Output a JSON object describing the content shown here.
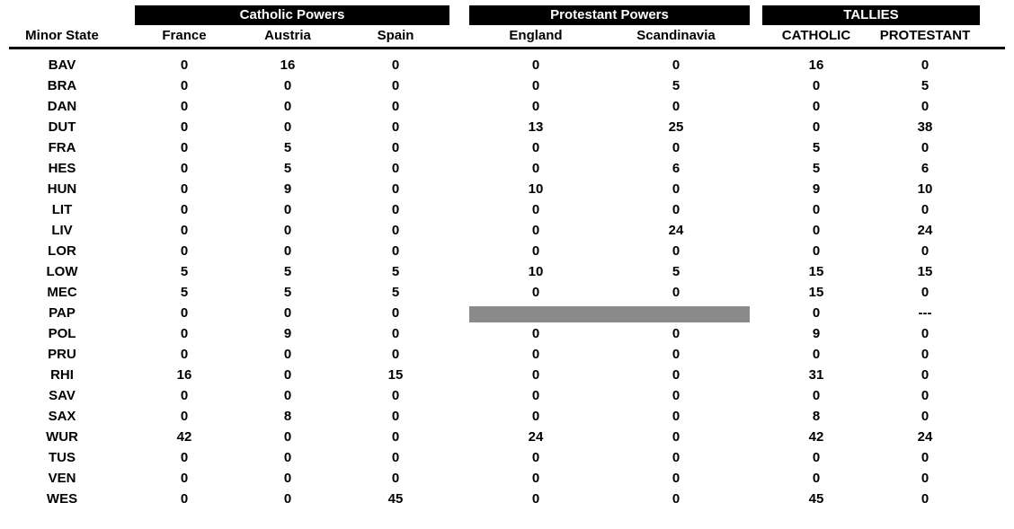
{
  "headers": {
    "minor_state": "Minor State",
    "group_catholic": "Catholic Powers",
    "group_protestant": "Protestant Powers",
    "group_tallies": "TALLIES",
    "france": "France",
    "austria": "Austria",
    "spain": "Spain",
    "england": "England",
    "scandinavia": "Scandinavia",
    "tally_catholic": "CATHOLIC",
    "tally_protestant": "PROTESTANT"
  },
  "chart_data": {
    "type": "table",
    "columns": [
      "Minor State",
      "France",
      "Austria",
      "Spain",
      "England",
      "Scandinavia",
      "CATHOLIC",
      "PROTESTANT"
    ],
    "rows": [
      {
        "state": "BAV",
        "france": "0",
        "austria": "16",
        "spain": "0",
        "england": "0",
        "scandinavia": "0",
        "tc": "16",
        "tp": "0",
        "grey": false
      },
      {
        "state": "BRA",
        "france": "0",
        "austria": "0",
        "spain": "0",
        "england": "0",
        "scandinavia": "5",
        "tc": "0",
        "tp": "5",
        "grey": false
      },
      {
        "state": "DAN",
        "france": "0",
        "austria": "0",
        "spain": "0",
        "england": "0",
        "scandinavia": "0",
        "tc": "0",
        "tp": "0",
        "grey": false
      },
      {
        "state": "DUT",
        "france": "0",
        "austria": "0",
        "spain": "0",
        "england": "13",
        "scandinavia": "25",
        "tc": "0",
        "tp": "38",
        "grey": false
      },
      {
        "state": "FRA",
        "france": "0",
        "austria": "5",
        "spain": "0",
        "england": "0",
        "scandinavia": "0",
        "tc": "5",
        "tp": "0",
        "grey": false
      },
      {
        "state": "HES",
        "france": "0",
        "austria": "5",
        "spain": "0",
        "england": "0",
        "scandinavia": "6",
        "tc": "5",
        "tp": "6",
        "grey": false
      },
      {
        "state": "HUN",
        "france": "0",
        "austria": "9",
        "spain": "0",
        "england": "10",
        "scandinavia": "0",
        "tc": "9",
        "tp": "10",
        "grey": false
      },
      {
        "state": "LIT",
        "france": "0",
        "austria": "0",
        "spain": "0",
        "england": "0",
        "scandinavia": "0",
        "tc": "0",
        "tp": "0",
        "grey": false
      },
      {
        "state": "LIV",
        "france": "0",
        "austria": "0",
        "spain": "0",
        "england": "0",
        "scandinavia": "24",
        "tc": "0",
        "tp": "24",
        "grey": false
      },
      {
        "state": "LOR",
        "france": "0",
        "austria": "0",
        "spain": "0",
        "england": "0",
        "scandinavia": "0",
        "tc": "0",
        "tp": "0",
        "grey": false
      },
      {
        "state": "LOW",
        "france": "5",
        "austria": "5",
        "spain": "5",
        "england": "10",
        "scandinavia": "5",
        "tc": "15",
        "tp": "15",
        "grey": false
      },
      {
        "state": "MEC",
        "france": "5",
        "austria": "5",
        "spain": "5",
        "england": "0",
        "scandinavia": "0",
        "tc": "15",
        "tp": "0",
        "grey": false
      },
      {
        "state": "PAP",
        "france": "0",
        "austria": "0",
        "spain": "0",
        "england": "",
        "scandinavia": "",
        "tc": "0",
        "tp": "---",
        "grey": true
      },
      {
        "state": "POL",
        "france": "0",
        "austria": "9",
        "spain": "0",
        "england": "0",
        "scandinavia": "0",
        "tc": "9",
        "tp": "0",
        "grey": false
      },
      {
        "state": "PRU",
        "france": "0",
        "austria": "0",
        "spain": "0",
        "england": "0",
        "scandinavia": "0",
        "tc": "0",
        "tp": "0",
        "grey": false
      },
      {
        "state": "RHI",
        "france": "16",
        "austria": "0",
        "spain": "15",
        "england": "0",
        "scandinavia": "0",
        "tc": "31",
        "tp": "0",
        "grey": false
      },
      {
        "state": "SAV",
        "france": "0",
        "austria": "0",
        "spain": "0",
        "england": "0",
        "scandinavia": "0",
        "tc": "0",
        "tp": "0",
        "grey": false
      },
      {
        "state": "SAX",
        "france": "0",
        "austria": "8",
        "spain": "0",
        "england": "0",
        "scandinavia": "0",
        "tc": "8",
        "tp": "0",
        "grey": false
      },
      {
        "state": "WUR",
        "france": "42",
        "austria": "0",
        "spain": "0",
        "england": "24",
        "scandinavia": "0",
        "tc": "42",
        "tp": "24",
        "grey": false
      },
      {
        "state": "TUS",
        "france": "0",
        "austria": "0",
        "spain": "0",
        "england": "0",
        "scandinavia": "0",
        "tc": "0",
        "tp": "0",
        "grey": false
      },
      {
        "state": "VEN",
        "france": "0",
        "austria": "0",
        "spain": "0",
        "england": "0",
        "scandinavia": "0",
        "tc": "0",
        "tp": "0",
        "grey": false
      },
      {
        "state": "WES",
        "france": "0",
        "austria": "0",
        "spain": "45",
        "england": "0",
        "scandinavia": "0",
        "tc": "45",
        "tp": "0",
        "grey": false
      }
    ]
  }
}
